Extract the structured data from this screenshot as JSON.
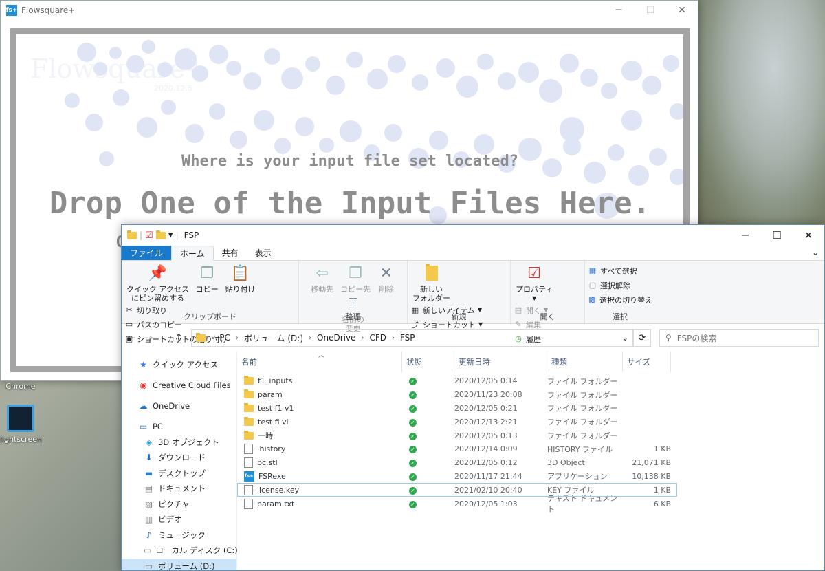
{
  "flowsquare": {
    "title": "Flowsquare+",
    "logo": "fs+",
    "watermark": "Flowsquare+",
    "watermark_sub": "2020.12.5",
    "question": "Where is your input file set located?",
    "drop_text": "Drop One of the Input Files Here.",
    "partial_text": "Or"
  },
  "desktop": {
    "chrome_label": "Chrome",
    "lightscreen_label": "lightscreen"
  },
  "explorer": {
    "title": "FSP",
    "tabs": [
      "ファイル",
      "ホーム",
      "共有",
      "表示"
    ],
    "ribbon": {
      "clipboard": {
        "pin": "クイック アクセス\nにピン留めする",
        "copy": "コピー",
        "paste": "貼り付け",
        "cut": "切り取り",
        "copy_path": "パスのコピー",
        "paste_shortcut": "ショートカットの貼り付け",
        "group": "クリップボード"
      },
      "organize": {
        "move_to": "移動先",
        "copy_to": "コピー先",
        "delete": "削除",
        "rename": "名前の\n変更",
        "group": "整理"
      },
      "new": {
        "new_folder": "新しい\nフォルダー",
        "new_item": "新しいアイテム",
        "shortcut": "ショートカット",
        "group": "新規"
      },
      "open": {
        "properties": "プロパティ",
        "open": "開く",
        "edit": "編集",
        "history": "履歴",
        "group": "開く"
      },
      "select": {
        "select_all": "すべて選択",
        "select_none": "選択解除",
        "invert": "選択の切り替え",
        "group": "選択"
      }
    },
    "address": [
      "PC",
      "ボリューム (D:)",
      "OneDrive",
      "CFD",
      "FSP"
    ],
    "search_placeholder": "FSPの検索",
    "nav": [
      "クイック アクセス",
      "Creative Cloud Files",
      "OneDrive",
      "PC",
      "3D オブジェクト",
      "ダウンロード",
      "デスクトップ",
      "ドキュメント",
      "ピクチャ",
      "ビデオ",
      "ミュージック",
      "ローカル ディスク (C:)",
      "ボリューム (D:)"
    ],
    "columns": [
      "名前",
      "状態",
      "更新日時",
      "種類",
      "サイズ"
    ],
    "files": [
      {
        "name": "f1_inputs",
        "date": "2020/12/05 0:14",
        "type": "ファイル フォルダー",
        "size": "",
        "icon": "folder"
      },
      {
        "name": "param",
        "date": "2020/11/23 20:08",
        "type": "ファイル フォルダー",
        "size": "",
        "icon": "folder"
      },
      {
        "name": "test f1 v1",
        "date": "2020/12/05 0:21",
        "type": "ファイル フォルダー",
        "size": "",
        "icon": "folder"
      },
      {
        "name": "test fi vi",
        "date": "2020/12/13 2:21",
        "type": "ファイル フォルダー",
        "size": "",
        "icon": "folder"
      },
      {
        "name": "一時",
        "date": "2020/12/05 0:13",
        "type": "ファイル フォルダー",
        "size": "",
        "icon": "folder"
      },
      {
        "name": ".history",
        "date": "2020/12/14 0:09",
        "type": "HISTORY ファイル",
        "size": "1 KB",
        "icon": "file"
      },
      {
        "name": "bc.stl",
        "date": "2020/12/05 0:12",
        "type": "3D Object",
        "size": "21,071 KB",
        "icon": "stl"
      },
      {
        "name": "FSRexe",
        "date": "2020/11/17 21:44",
        "type": "アプリケーション",
        "size": "10,138 KB",
        "icon": "app"
      },
      {
        "name": "license.key",
        "date": "2021/02/10 20:40",
        "type": "KEY ファイル",
        "size": "1 KB",
        "icon": "file"
      },
      {
        "name": "param.txt",
        "date": "2020/12/05 1:03",
        "type": "テキスト ドキュメント",
        "size": "6 KB",
        "icon": "file"
      }
    ]
  }
}
